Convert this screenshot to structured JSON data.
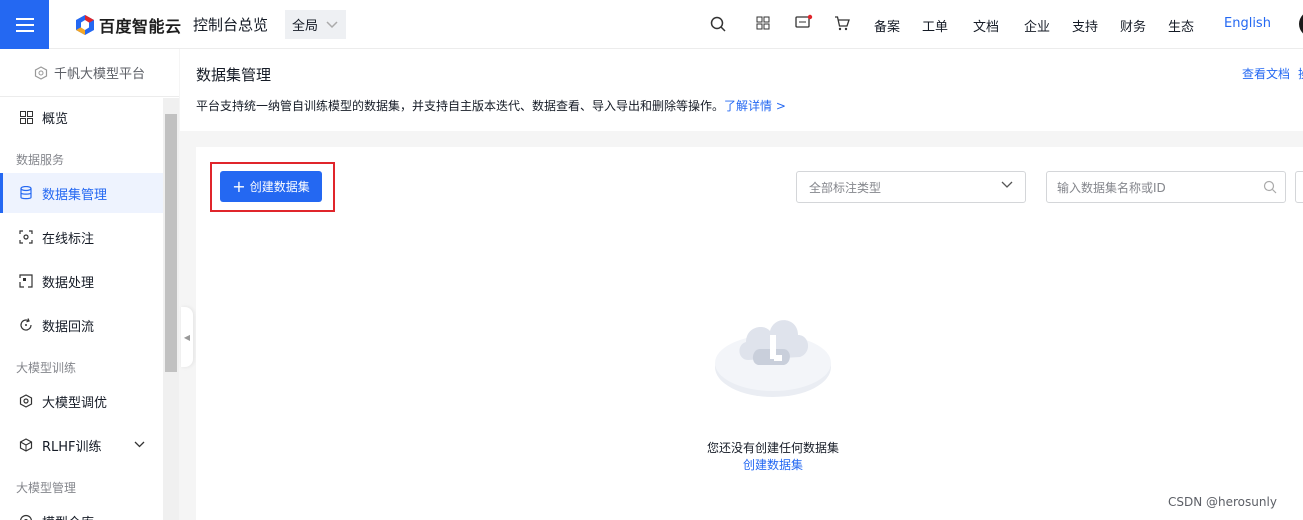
{
  "topbar": {
    "brand": "百度智能云",
    "console": "控制台总览",
    "region": "全局",
    "nav": [
      "备案",
      "工单",
      "文档",
      "企业",
      "支持",
      "财务",
      "生态"
    ],
    "language": "English"
  },
  "sidebar": {
    "platform": "千帆大模型平台",
    "overview": "概览",
    "group_data": "数据服务",
    "items_data": [
      "数据集管理",
      "在线标注",
      "数据处理",
      "数据回流"
    ],
    "group_train": "大模型训练",
    "items_train": [
      "大模型调优",
      "RLHF训练"
    ],
    "group_manage": "大模型管理",
    "items_manage": [
      "模型仓库"
    ]
  },
  "main": {
    "title": "数据集管理",
    "doc_link": "查看文档",
    "doc_link_cut": "操",
    "description": "平台支持统一纳管自训练模型的数据集，并支持自主版本迭代、数据查看、导入导出和删除等操作。",
    "learn_more": "了解详情 >",
    "create_button": "创建数据集",
    "filter_placeholder": "全部标注类型",
    "search_placeholder": "输入数据集名称或ID",
    "empty_message": "您还没有创建任何数据集",
    "empty_link": "创建数据集"
  },
  "watermark": "CSDN @herosunly",
  "colors": {
    "brand": "#2468f2",
    "highlight": "#e0252b"
  }
}
